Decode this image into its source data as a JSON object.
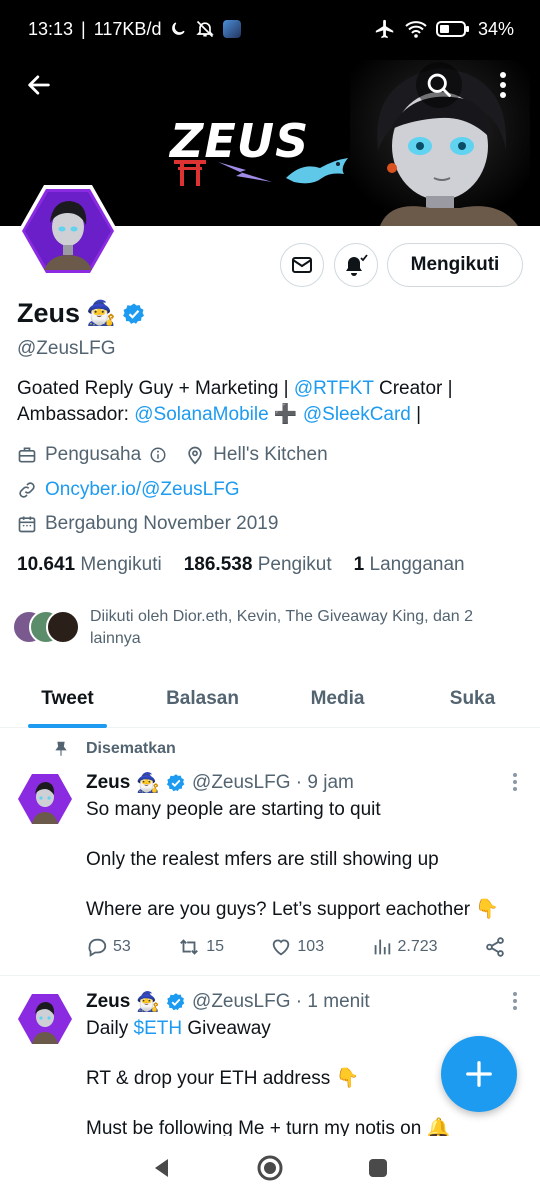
{
  "status_bar": {
    "time": "13:13",
    "speed": "117KB/d",
    "battery": "34%"
  },
  "banner": {
    "logo_text": "ZEUS"
  },
  "profile": {
    "display_name": "Zeus",
    "name_emoji": "🧙‍♂️",
    "handle": "@ZeusLFG",
    "follow_button": "Mengikuti",
    "bio": {
      "part1": "Goated Reply Guy + Marketing | ",
      "mention1": "@RTFKT",
      "part2": " Creator | Ambassador: ",
      "mention2": "@SolanaMobile",
      "part3": " ➕ ",
      "mention3": "@SleekCard",
      "part4": " |"
    },
    "profession": "Pengusaha",
    "location": "Hell's Kitchen",
    "website": "Oncyber.io/@ZeusLFG",
    "joined": "Bergabung November 2019",
    "following_count": "10.641",
    "following_label": "Mengikuti",
    "followers_count": "186.538",
    "followers_label": "Pengikut",
    "subs_count": "1",
    "subs_label": "Langganan",
    "followed_by": "Diikuti oleh Dior.eth, Kevin, The Giveaway King, dan 2 lainnya"
  },
  "tabs": [
    {
      "label": "Tweet"
    },
    {
      "label": "Balasan"
    },
    {
      "label": "Media"
    },
    {
      "label": "Suka"
    }
  ],
  "tweets": [
    {
      "pinned_label": "Disematkan",
      "name": "Zeus",
      "emoji": "🧙‍♂️",
      "handle_time": "@ZeusLFG · 9 jam",
      "line1": "So many people are starting to quit",
      "line2": "Only the realest mfers are still showing up",
      "line3": "Where are you guys? Let’s support eachother 👇",
      "replies": "53",
      "retweets": "15",
      "likes": "103",
      "views": "2.723"
    },
    {
      "name": "Zeus",
      "emoji": "🧙‍♂️",
      "handle_time": "@ZeusLFG · 1 menit",
      "line1_prefix": "Daily ",
      "line1_tag": "$ETH",
      "line1_suffix": " Giveaway",
      "line2": "RT & drop your ETH address 👇",
      "line3": "Must be following Me + turn my notis on 🔔"
    }
  ],
  "colors": {
    "accent": "#1d9bf0",
    "text": "#0f1419",
    "secondary_text": "#536471",
    "avatar_border": "#8a2be2"
  }
}
